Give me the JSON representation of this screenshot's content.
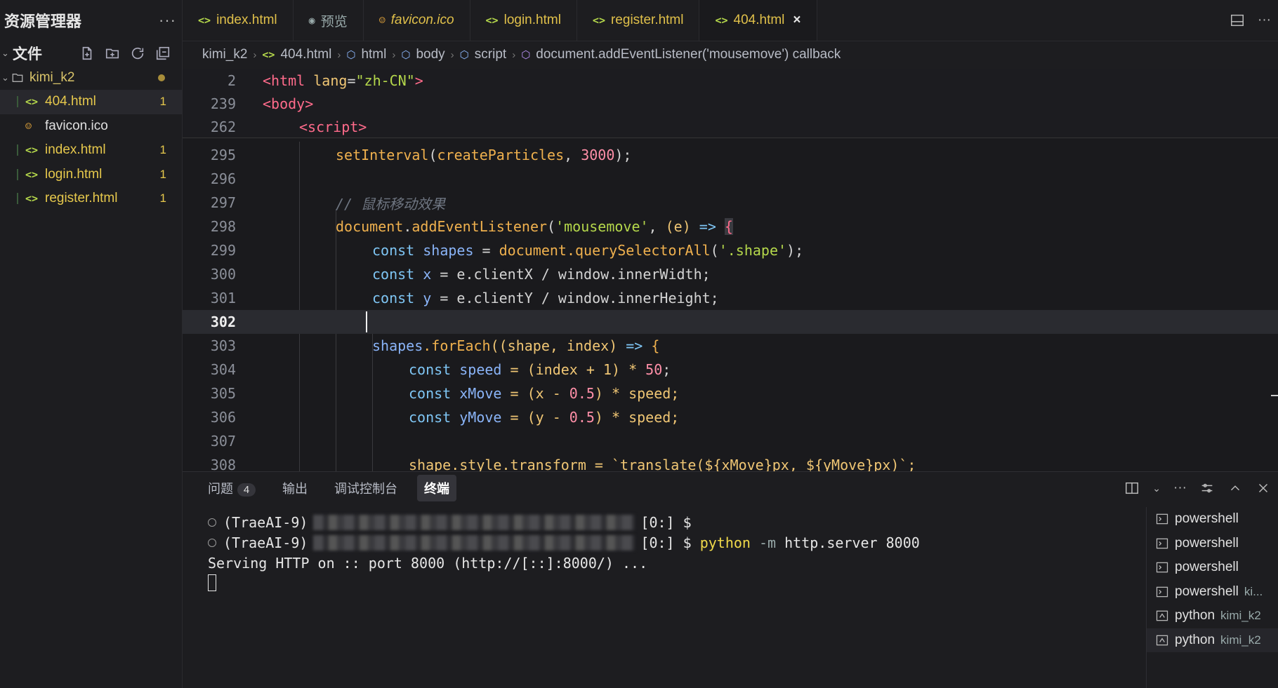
{
  "sidebar": {
    "title": "资源管理器",
    "more": "···",
    "section": "文件",
    "folder": "kimi_k2",
    "files": [
      {
        "icon": "<>",
        "name": "404.html",
        "badge": "1"
      },
      {
        "icon": "ico",
        "name": "favicon.ico",
        "badge": ""
      },
      {
        "icon": "<>",
        "name": "index.html",
        "badge": "1"
      },
      {
        "icon": "<>",
        "name": "login.html",
        "badge": "1"
      },
      {
        "icon": "<>",
        "name": "register.html",
        "badge": "1"
      }
    ]
  },
  "tabs": [
    {
      "label": "index.html",
      "icon": "<>"
    },
    {
      "label": "预览",
      "icon": "eye"
    },
    {
      "label": "favicon.ico",
      "icon": "ico"
    },
    {
      "label": "login.html",
      "icon": "<>"
    },
    {
      "label": "register.html",
      "icon": "<>"
    },
    {
      "label": "404.html",
      "icon": "<>",
      "close": "×"
    }
  ],
  "breadcrumb": {
    "root": "kimi_k2",
    "file": "404.html",
    "html": "html",
    "body": "body",
    "script": "script",
    "callback": "document.addEventListener('mousemove') callback"
  },
  "editor": {
    "current_line": "302",
    "lines": [
      {
        "n": "2"
      },
      {
        "n": "239"
      },
      {
        "n": "262"
      },
      {
        "n": "295"
      },
      {
        "n": "296"
      },
      {
        "n": "297"
      },
      {
        "n": "298"
      },
      {
        "n": "299"
      },
      {
        "n": "300"
      },
      {
        "n": "301"
      },
      {
        "n": "302"
      },
      {
        "n": "303"
      },
      {
        "n": "304"
      },
      {
        "n": "305"
      },
      {
        "n": "306"
      },
      {
        "n": "307"
      },
      {
        "n": "308"
      }
    ],
    "code": {
      "l2_tag": "<html",
      "l2_attr": " lang",
      "l2_eq": "=",
      "l2_str": "\"zh-CN\"",
      "l2_close": ">",
      "l239": "<body>",
      "l262": "<script>",
      "l295_fn": "setInterval",
      "l295_a": "(",
      "l295_b": "createParticles",
      "l295_c": ", ",
      "l295_num": "3000",
      "l295_d": ");",
      "l297": "// 鼠标移动效果",
      "l298_obj": "document",
      "l298_dot": ".",
      "l298_fn": "addEventListener",
      "l298_p": "(",
      "l298_str": "'mousemove'",
      "l298_c": ", ",
      "l298_e": "(e)",
      "l298_arrow": " => ",
      "l298_brace": "{",
      "l299_kw": "const",
      "l299_var": " shapes",
      "l299_eq": " = ",
      "l299_obj": "document",
      "l299_fn": ".querySelectorAll",
      "l299_p": "(",
      "l299_str": "'.shape'",
      "l299_end": ");",
      "l300_kw": "const",
      "l300_var": " x",
      "l300_rest": " = e.clientX / window.innerWidth;",
      "l301_kw": "const",
      "l301_var": " y",
      "l301_rest": " = e.clientY / window.innerHeight;",
      "l303_var": "shapes",
      "l303_fn": ".forEach",
      "l303_args": "((shape, index)",
      "l303_arrow": " => ",
      "l303_brace": "{",
      "l304_kw": "const",
      "l304_var": " speed",
      "l304_rest": " = (index + 1) * ",
      "l304_num": "50",
      "l304_end": ";",
      "l305_kw": "const",
      "l305_var": " xMove",
      "l305_rest": " = (x - ",
      "l305_num": "0.5",
      "l305_end": ") * speed;",
      "l306_kw": "const",
      "l306_var": " yMove",
      "l306_rest": " = (y - ",
      "l306_num": "0.5",
      "l306_end": ") * speed;",
      "l308": "shape.style.transform = `translate(${xMove}px, ${yMove}px)`;"
    }
  },
  "panel": {
    "tabs": [
      "问题",
      "输出",
      "调试控制台",
      "终端"
    ],
    "problems_count": "4",
    "terminal": {
      "line1_prefix": "(TraeAI-9)",
      "line1_suffix": "[0:] $",
      "line2_prefix": "(TraeAI-9)",
      "line2_suffix": "[0:] $ ",
      "line2_cmd": "python",
      "line2_flag": " -m",
      "line2_args": " http.server 8000",
      "line3": "Serving HTTP on :: port 8000 (http://[::]:8000/) ..."
    },
    "terminal_list": [
      {
        "name": "powershell",
        "sub": ""
      },
      {
        "name": "powershell",
        "sub": ""
      },
      {
        "name": "powershell",
        "sub": ""
      },
      {
        "name": "powershell",
        "sub": "ki..."
      },
      {
        "name": "python",
        "sub": "kimi_k2"
      },
      {
        "name": "python",
        "sub": "kimi_k2"
      }
    ]
  }
}
